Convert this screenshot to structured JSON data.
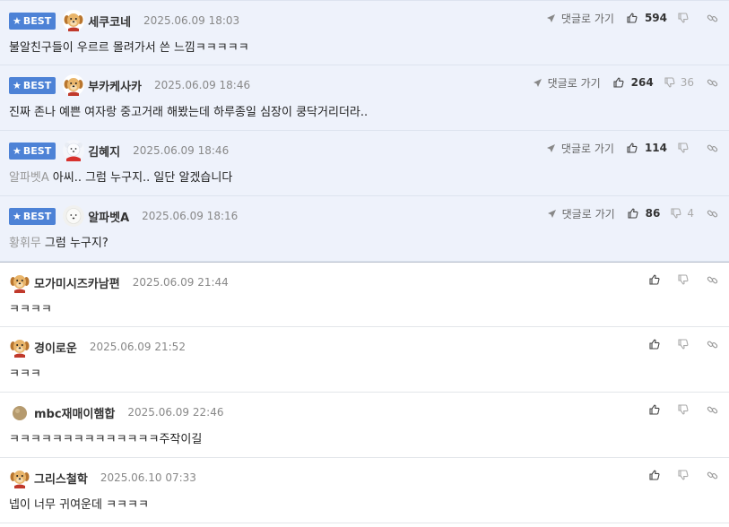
{
  "best_badge_label": "BEST",
  "reply_label": "댓글로 가기",
  "colors": {
    "best_bg": "#eef2fb",
    "badge_bg": "#4d82d6",
    "date": "#888888"
  },
  "comments": [
    {
      "best": true,
      "avatar": "puppy-avatar",
      "nick": "세쿠코네",
      "date": "2025.06.09 18:03",
      "mention": "",
      "text": "불알친구들이 우르르 몰려가서 쓴 느낌ㅋㅋㅋㅋㅋ",
      "likes": "594",
      "dislikes": ""
    },
    {
      "best": true,
      "avatar": "puppy-avatar",
      "nick": "부카케사카",
      "date": "2025.06.09 18:46",
      "mention": "",
      "text": "진짜 존나 예쁜 여자랑 중고거래 해봤는데 하루종일 심장이 쿵닥거리더라..",
      "likes": "264",
      "dislikes": "36"
    },
    {
      "best": true,
      "avatar": "polar-bear-avatar",
      "nick": "김혜지",
      "date": "2025.06.09 18:46",
      "mention": "알파벳A",
      "text": "아씨.. 그럼 누구지.. 일단 알겠습니다",
      "likes": "114",
      "dislikes": ""
    },
    {
      "best": true,
      "avatar": "white-dog-avatar",
      "nick": "알파벳A",
      "date": "2025.06.09 18:16",
      "mention": "황휘무",
      "text": "그럼 누구지?",
      "likes": "86",
      "dislikes": "4"
    },
    {
      "best": false,
      "avatar": "puppy-avatar",
      "nick": "모가미시즈카남편",
      "date": "2025.06.09 21:44",
      "mention": "",
      "text": "ㅋㅋㅋㅋ",
      "likes": "",
      "dislikes": ""
    },
    {
      "best": false,
      "avatar": "puppy-avatar",
      "nick": "경이로운",
      "date": "2025.06.09 21:52",
      "mention": "",
      "text": "ㅋㅋㅋ",
      "likes": "",
      "dislikes": ""
    },
    {
      "best": false,
      "avatar": "ball-avatar",
      "nick": "mbc재매이햄합",
      "date": "2025.06.09 22:46",
      "mention": "",
      "text": "ㅋㅋㅋㅋㅋㅋㅋㅋㅋㅋㅋㅋㅋㅋ주작이길",
      "likes": "",
      "dislikes": ""
    },
    {
      "best": false,
      "avatar": "puppy-avatar",
      "nick": "그리스철학",
      "date": "2025.06.10 07:33",
      "mention": "",
      "text": "넵이 너무 귀여운데 ㅋㅋㅋㅋ",
      "likes": "",
      "dislikes": ""
    }
  ]
}
